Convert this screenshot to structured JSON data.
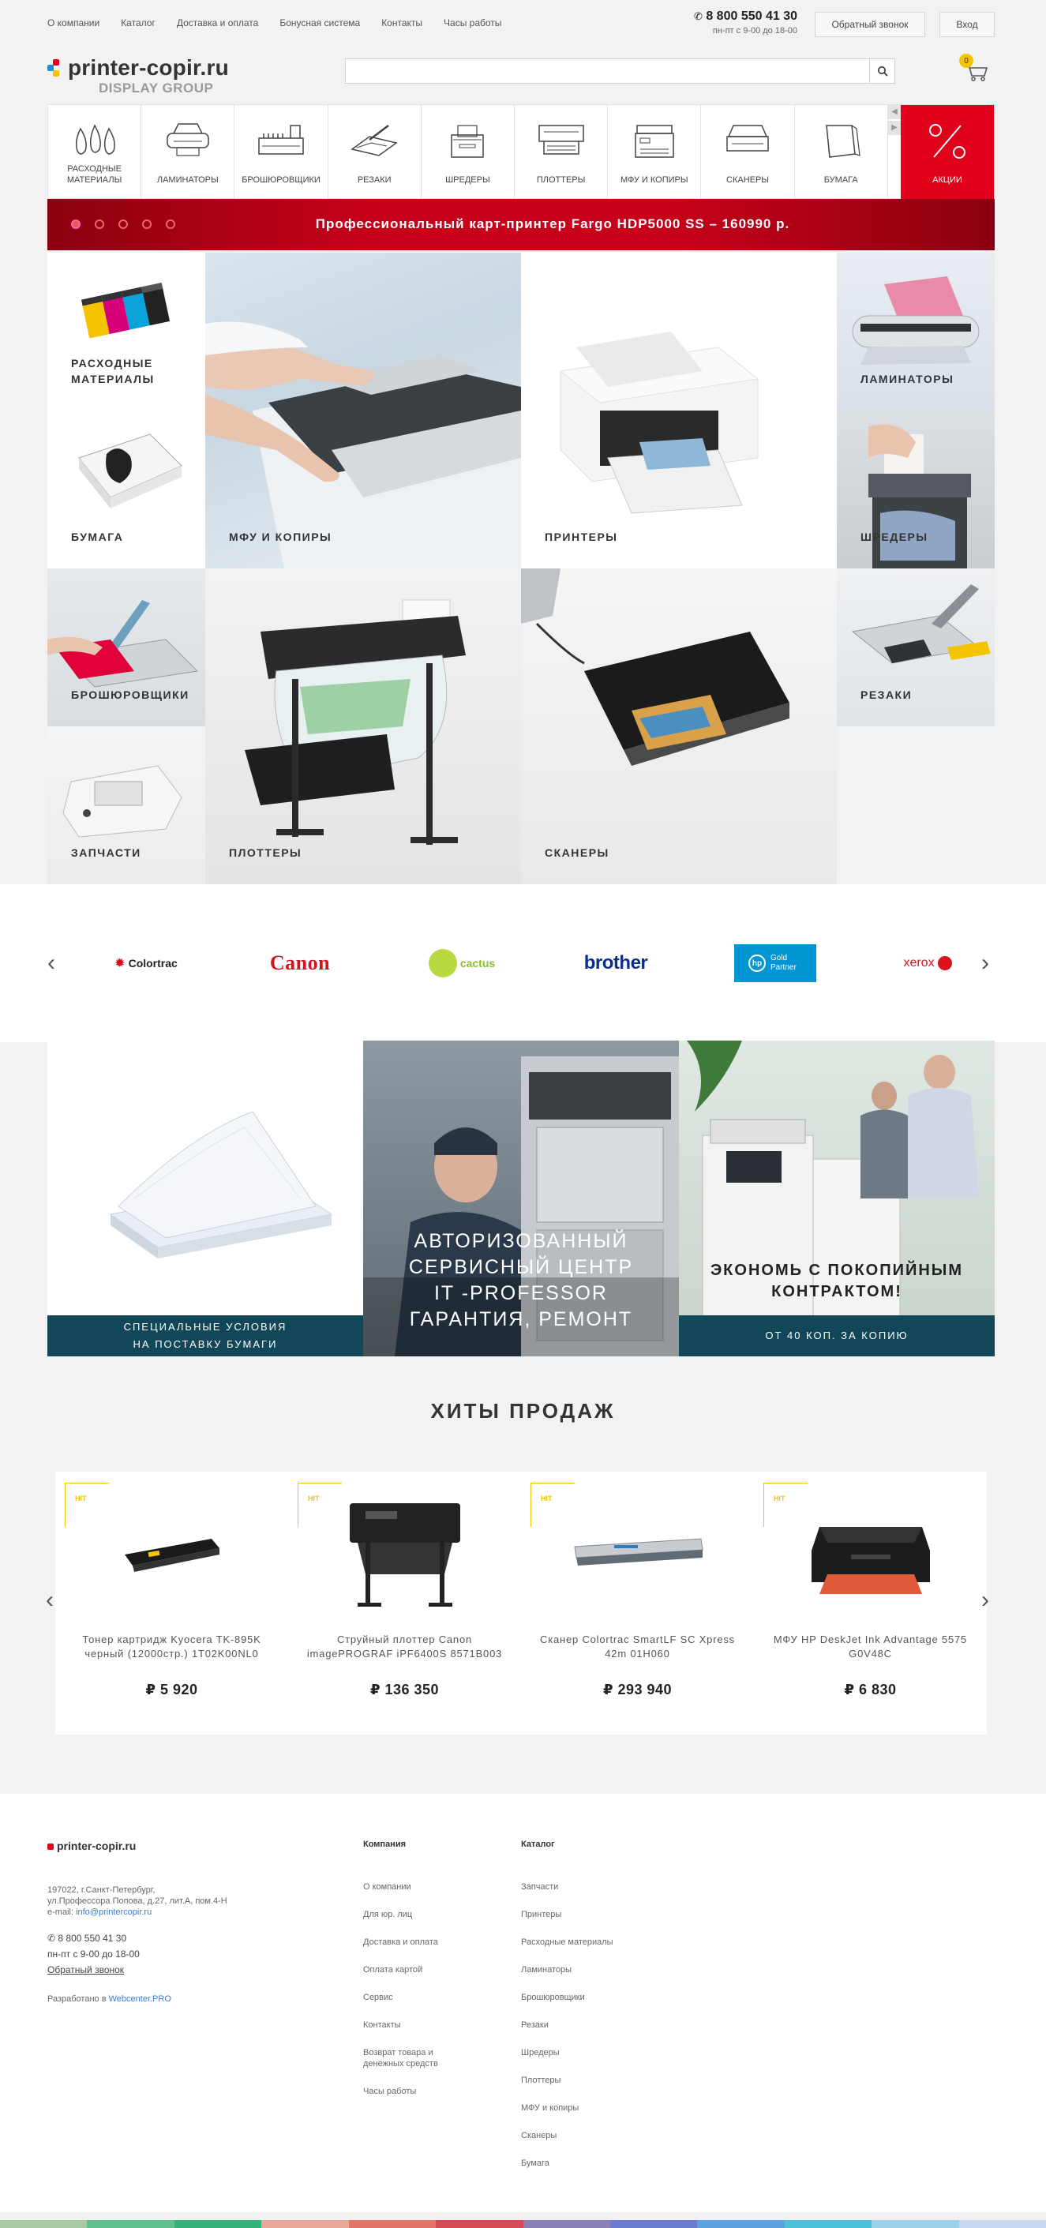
{
  "topnav": [
    "О компании",
    "Каталог",
    "Доставка и оплата",
    "Бонусная система",
    "Контакты",
    "Часы работы"
  ],
  "contact": {
    "phone": "8 800 550 41 30",
    "hours": "пн-пт с 9-00 до 18-00"
  },
  "header": {
    "callback": "Обратный звонок",
    "login": "Вход",
    "cart_count": "0"
  },
  "logo": {
    "name": "printer-copir.ru",
    "sub": "DISPLAY GROUP"
  },
  "search": {
    "placeholder": ""
  },
  "categories": [
    {
      "label": "РАСХОДНЫЕ МАТЕРИАЛЫ",
      "icon": "consumables-icon"
    },
    {
      "label": "ЛАМИНАТОРЫ",
      "icon": "laminator-icon"
    },
    {
      "label": "БРОШЮРОВЩИКИ",
      "icon": "binder-icon"
    },
    {
      "label": "РЕЗАКИ",
      "icon": "cutter-icon"
    },
    {
      "label": "ШРЕДЕРЫ",
      "icon": "shredder-icon"
    },
    {
      "label": "ПЛОТТЕРЫ",
      "icon": "plotter-icon"
    },
    {
      "label": "МФУ И КОПИРЫ",
      "icon": "mfp-icon"
    },
    {
      "label": "СКАНЕРЫ",
      "icon": "scanner-icon"
    },
    {
      "label": "БУМАГА",
      "icon": "paper-icon"
    },
    {
      "label": "АКЦИИ",
      "icon": "percent-icon"
    }
  ],
  "banner": {
    "text": "Профессиональный карт-принтер Fargo HDP5000 SS – 160990 р.",
    "slides": 5
  },
  "tiles": {
    "consumables": "РАСХОДНЫЕ\nМАТЕРИАЛЫ",
    "mfp": "МФУ И КОПИРЫ",
    "printers": "ПРИНТЕРЫ",
    "laminators": "ЛАМИНАТОРЫ",
    "paper": "БУМАГА",
    "shredders": "ШРЕДЕРЫ",
    "binders": "БРОШЮРОВЩИКИ",
    "plotters": "ПЛОТТЕРЫ",
    "scanners": "СКАНЕРЫ",
    "cutters": "РЕЗАКИ",
    "parts": "ЗАПЧАСТИ"
  },
  "brands": {
    "colortrac": "Colortrac",
    "canon": "Canon",
    "cactus": "cactus",
    "brother": "brother",
    "hp": "Gold Partner",
    "xerox": "xerox"
  },
  "promos": {
    "paper": "СПЕЦИАЛЬНЫЕ УСЛОВИЯ\nНА ПОСТАВКУ БУМАГИ",
    "service": "АВТОРИЗОВАННЫЙ\nСЕРВИСНЫЙ ЦЕНТР\nIT -PROFESSOR\nГАРАНТИЯ, РЕМОНТ",
    "contract": "ЭКОНОМЬ С ПОКОПИЙНЫМ\nКОНТРАКТОМ!",
    "contract_caption": "ОТ 40 КОП. ЗА КОПИЮ"
  },
  "hits": {
    "title": "ХИТЫ ПРОДАЖ",
    "badge": "HIT",
    "items": [
      {
        "name": "Тонер картридж Kyocera TK-895K черный (12000стр.) 1T02K00NL0",
        "price": "₽ 5 920"
      },
      {
        "name": "Струйный плоттер Canon imagePROGRAF iPF6400S 8571B003",
        "price": "₽ 136 350"
      },
      {
        "name": "Сканер Colortrac SmartLF SC Xpress 42m 01H060",
        "price": "₽ 293 940"
      },
      {
        "name": "МФУ HP DeskJet Ink Advantage 5575 G0V48C",
        "price": "₽ 6 830"
      }
    ]
  },
  "footer": {
    "logo": "printer-copir.ru",
    "address": [
      "197022, г.Санкт-Петербург,",
      "ул.Профессора Попова, д.27, лит.А, пом.4-Н"
    ],
    "email_label": "e-mail: ",
    "email": "info@printercopir.ru",
    "phone": "8 800 550 41 30",
    "hours": "пн-пт с 9-00 до 18-00",
    "callback": "Обратный звонок",
    "dev_label": "Разработано в ",
    "dev": "Webcenter.PRO",
    "company_head": "Компания",
    "company_links": [
      "О компании",
      "Для юр. лиц",
      "Доставка и оплата",
      "Оплата картой",
      "Сервис",
      "Контакты",
      "Возврат товара и",
      "денежных средств",
      "Часы работы"
    ],
    "catalog_head": "Каталог",
    "catalog_links": [
      "Запчасти",
      "Принтеры",
      "Расходные материалы",
      "Ламинаторы",
      "Брошюровщики",
      "Резаки",
      "Шредеры",
      "Плоттеры",
      "МФУ и копиры",
      "Сканеры",
      "Бумага"
    ]
  },
  "colors": {
    "accent_red": "#e0001a",
    "caption_teal": "#12475a",
    "hit_yellow": "#f5c400",
    "link_blue": "#3a7bd5"
  }
}
